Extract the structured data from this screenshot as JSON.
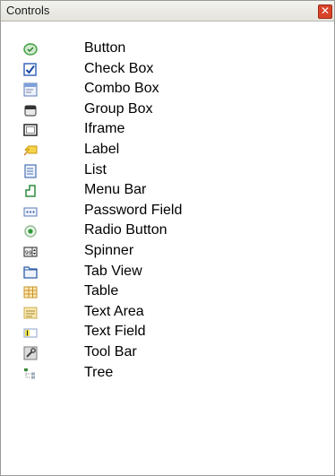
{
  "panel": {
    "title": "Controls",
    "close_glyph": "✕"
  },
  "items": [
    {
      "label": "Button",
      "icon": "button-icon"
    },
    {
      "label": "Check Box",
      "icon": "check-box-icon"
    },
    {
      "label": "Combo Box",
      "icon": "combo-box-icon"
    },
    {
      "label": "Group Box",
      "icon": "group-box-icon"
    },
    {
      "label": "Iframe",
      "icon": "iframe-icon"
    },
    {
      "label": "Label",
      "icon": "label-icon"
    },
    {
      "label": "List",
      "icon": "list-icon"
    },
    {
      "label": "Menu Bar",
      "icon": "menu-bar-icon"
    },
    {
      "label": "Password Field",
      "icon": "password-field-icon"
    },
    {
      "label": "Radio Button",
      "icon": "radio-button-icon"
    },
    {
      "label": "Spinner",
      "icon": "spinner-icon"
    },
    {
      "label": "Tab View",
      "icon": "tab-view-icon"
    },
    {
      "label": "Table",
      "icon": "table-icon"
    },
    {
      "label": "Text Area",
      "icon": "text-area-icon"
    },
    {
      "label": "Text Field",
      "icon": "text-field-icon"
    },
    {
      "label": "Tool Bar",
      "icon": "tool-bar-icon"
    },
    {
      "label": "Tree",
      "icon": "tree-icon"
    }
  ]
}
